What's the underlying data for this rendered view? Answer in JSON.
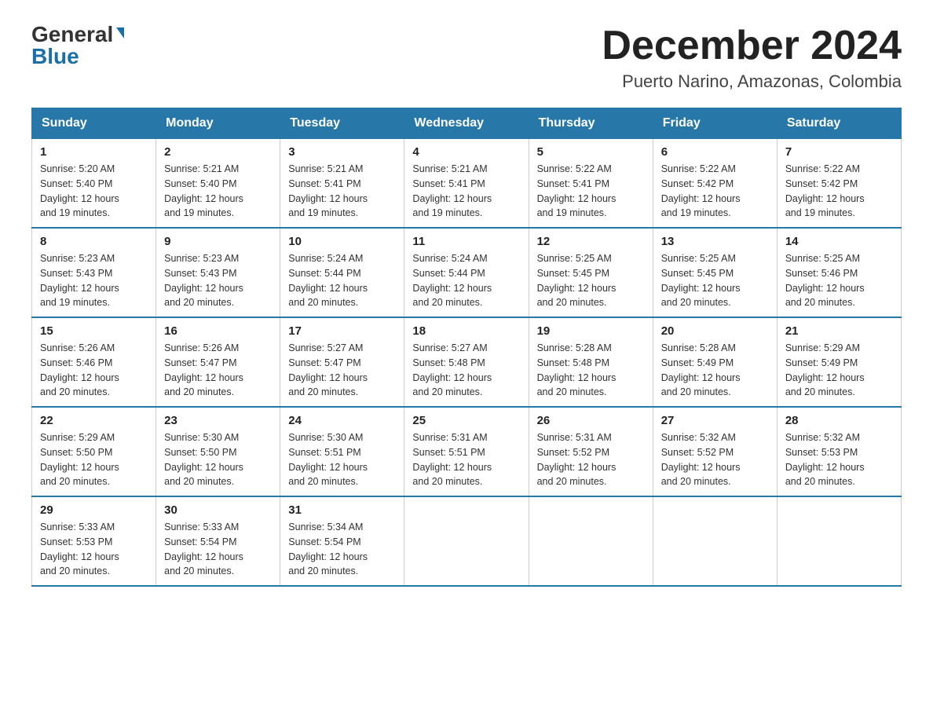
{
  "logo": {
    "general": "General",
    "blue": "Blue"
  },
  "title": {
    "month": "December 2024",
    "location": "Puerto Narino, Amazonas, Colombia"
  },
  "header": {
    "days": [
      "Sunday",
      "Monday",
      "Tuesday",
      "Wednesday",
      "Thursday",
      "Friday",
      "Saturday"
    ]
  },
  "weeks": [
    [
      {
        "day": "1",
        "sunrise": "5:20 AM",
        "sunset": "5:40 PM",
        "daylight": "12 hours and 19 minutes."
      },
      {
        "day": "2",
        "sunrise": "5:21 AM",
        "sunset": "5:40 PM",
        "daylight": "12 hours and 19 minutes."
      },
      {
        "day": "3",
        "sunrise": "5:21 AM",
        "sunset": "5:41 PM",
        "daylight": "12 hours and 19 minutes."
      },
      {
        "day": "4",
        "sunrise": "5:21 AM",
        "sunset": "5:41 PM",
        "daylight": "12 hours and 19 minutes."
      },
      {
        "day": "5",
        "sunrise": "5:22 AM",
        "sunset": "5:41 PM",
        "daylight": "12 hours and 19 minutes."
      },
      {
        "day": "6",
        "sunrise": "5:22 AM",
        "sunset": "5:42 PM",
        "daylight": "12 hours and 19 minutes."
      },
      {
        "day": "7",
        "sunrise": "5:22 AM",
        "sunset": "5:42 PM",
        "daylight": "12 hours and 19 minutes."
      }
    ],
    [
      {
        "day": "8",
        "sunrise": "5:23 AM",
        "sunset": "5:43 PM",
        "daylight": "12 hours and 19 minutes."
      },
      {
        "day": "9",
        "sunrise": "5:23 AM",
        "sunset": "5:43 PM",
        "daylight": "12 hours and 20 minutes."
      },
      {
        "day": "10",
        "sunrise": "5:24 AM",
        "sunset": "5:44 PM",
        "daylight": "12 hours and 20 minutes."
      },
      {
        "day": "11",
        "sunrise": "5:24 AM",
        "sunset": "5:44 PM",
        "daylight": "12 hours and 20 minutes."
      },
      {
        "day": "12",
        "sunrise": "5:25 AM",
        "sunset": "5:45 PM",
        "daylight": "12 hours and 20 minutes."
      },
      {
        "day": "13",
        "sunrise": "5:25 AM",
        "sunset": "5:45 PM",
        "daylight": "12 hours and 20 minutes."
      },
      {
        "day": "14",
        "sunrise": "5:25 AM",
        "sunset": "5:46 PM",
        "daylight": "12 hours and 20 minutes."
      }
    ],
    [
      {
        "day": "15",
        "sunrise": "5:26 AM",
        "sunset": "5:46 PM",
        "daylight": "12 hours and 20 minutes."
      },
      {
        "day": "16",
        "sunrise": "5:26 AM",
        "sunset": "5:47 PM",
        "daylight": "12 hours and 20 minutes."
      },
      {
        "day": "17",
        "sunrise": "5:27 AM",
        "sunset": "5:47 PM",
        "daylight": "12 hours and 20 minutes."
      },
      {
        "day": "18",
        "sunrise": "5:27 AM",
        "sunset": "5:48 PM",
        "daylight": "12 hours and 20 minutes."
      },
      {
        "day": "19",
        "sunrise": "5:28 AM",
        "sunset": "5:48 PM",
        "daylight": "12 hours and 20 minutes."
      },
      {
        "day": "20",
        "sunrise": "5:28 AM",
        "sunset": "5:49 PM",
        "daylight": "12 hours and 20 minutes."
      },
      {
        "day": "21",
        "sunrise": "5:29 AM",
        "sunset": "5:49 PM",
        "daylight": "12 hours and 20 minutes."
      }
    ],
    [
      {
        "day": "22",
        "sunrise": "5:29 AM",
        "sunset": "5:50 PM",
        "daylight": "12 hours and 20 minutes."
      },
      {
        "day": "23",
        "sunrise": "5:30 AM",
        "sunset": "5:50 PM",
        "daylight": "12 hours and 20 minutes."
      },
      {
        "day": "24",
        "sunrise": "5:30 AM",
        "sunset": "5:51 PM",
        "daylight": "12 hours and 20 minutes."
      },
      {
        "day": "25",
        "sunrise": "5:31 AM",
        "sunset": "5:51 PM",
        "daylight": "12 hours and 20 minutes."
      },
      {
        "day": "26",
        "sunrise": "5:31 AM",
        "sunset": "5:52 PM",
        "daylight": "12 hours and 20 minutes."
      },
      {
        "day": "27",
        "sunrise": "5:32 AM",
        "sunset": "5:52 PM",
        "daylight": "12 hours and 20 minutes."
      },
      {
        "day": "28",
        "sunrise": "5:32 AM",
        "sunset": "5:53 PM",
        "daylight": "12 hours and 20 minutes."
      }
    ],
    [
      {
        "day": "29",
        "sunrise": "5:33 AM",
        "sunset": "5:53 PM",
        "daylight": "12 hours and 20 minutes."
      },
      {
        "day": "30",
        "sunrise": "5:33 AM",
        "sunset": "5:54 PM",
        "daylight": "12 hours and 20 minutes."
      },
      {
        "day": "31",
        "sunrise": "5:34 AM",
        "sunset": "5:54 PM",
        "daylight": "12 hours and 20 minutes."
      },
      null,
      null,
      null,
      null
    ]
  ],
  "labels": {
    "sunrise": "Sunrise:",
    "sunset": "Sunset:",
    "daylight": "Daylight:"
  }
}
